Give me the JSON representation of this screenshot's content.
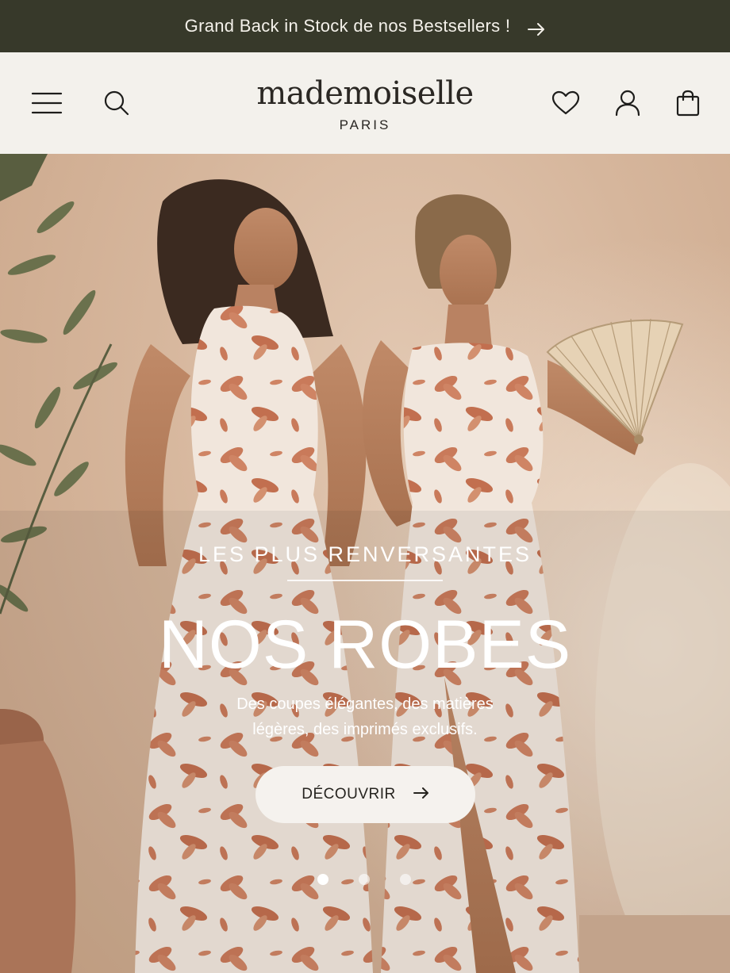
{
  "announcement": {
    "text": "Grand Back in Stock de nos Bestsellers !",
    "arrow_icon": "arrow-right-icon"
  },
  "header": {
    "menu_icon": "hamburger-menu-icon",
    "search_icon": "search-icon",
    "logo": {
      "brand": "mademoiselle",
      "city": "PARIS"
    },
    "wishlist_icon": "heart-icon",
    "account_icon": "user-icon",
    "cart_icon": "shopping-bag-icon"
  },
  "hero": {
    "kicker": "LES PLUS RENVERSANTES",
    "headline": "NOS ROBES",
    "description_line1": "Des coupes élégantes, des matières",
    "description_line2": "légères, des imprimés exclusifs.",
    "cta_label": "DÉCOUVRIR",
    "slide_count": 3,
    "active_slide": 1
  },
  "colors": {
    "announcement_bg": "#37392a",
    "header_bg": "#f3f1ec",
    "hero_wall": "#d6b69c",
    "dress_print": "#c97a5a"
  }
}
